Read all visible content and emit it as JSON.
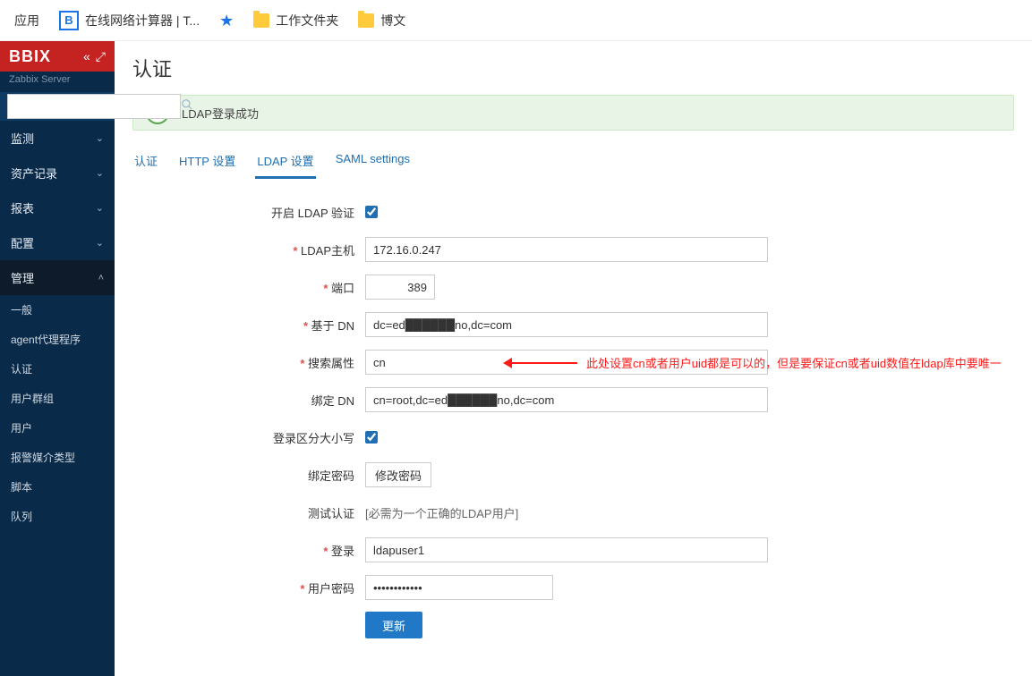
{
  "bookmarks": {
    "apps": "应用",
    "calc": "在线网络计算器 | T...",
    "work_folder": "工作文件夹",
    "blog": "博文"
  },
  "sidebar": {
    "brand": "BBIX",
    "server": "Zabbix Server",
    "search_placeholder": "",
    "groups": {
      "monitor": "监测",
      "inventory": "资产记录",
      "report": "报表",
      "config": "配置",
      "admin": "管理"
    },
    "subs": {
      "general": "一般",
      "agent": "agent代理程序",
      "auth": "认证",
      "usergroup": "用户群组",
      "user": "用户",
      "media": "报警媒介类型",
      "script": "脚本",
      "queue": "队列"
    }
  },
  "page": {
    "title": "认证",
    "alert": "LDAP登录成功"
  },
  "tabs": {
    "auth": "认证",
    "http": "HTTP 设置",
    "ldap": "LDAP 设置",
    "saml": "SAML settings"
  },
  "form": {
    "enable_label": "开启 LDAP 验证",
    "host_label": "LDAP主机",
    "host_value": "172.16.0.247",
    "port_label": "端口",
    "port_value": "389",
    "base_dn_label": "基于 DN",
    "base_dn_value": "dc=ed██████no,dc=com",
    "search_attr_label": "搜索属性",
    "search_attr_value": "cn",
    "bind_dn_label": "绑定 DN",
    "bind_dn_value": "cn=root,dc=ed██████no,dc=com",
    "case_label": "登录区分大小写",
    "bind_pw_label": "绑定密码",
    "change_pw_btn": "修改密码",
    "test_auth_label": "测试认证",
    "test_auth_hint": "[必需为一个正确的LDAP用户]",
    "login_label": "登录",
    "login_value": "ldapuser1",
    "user_pw_label": "用户密码",
    "user_pw_value": "••••••••••••",
    "update_btn": "更新"
  },
  "annotation": {
    "text": "此处设置cn或者用户uid都是可以的，但是要保证cn或者uid数值在ldap库中要唯一"
  }
}
